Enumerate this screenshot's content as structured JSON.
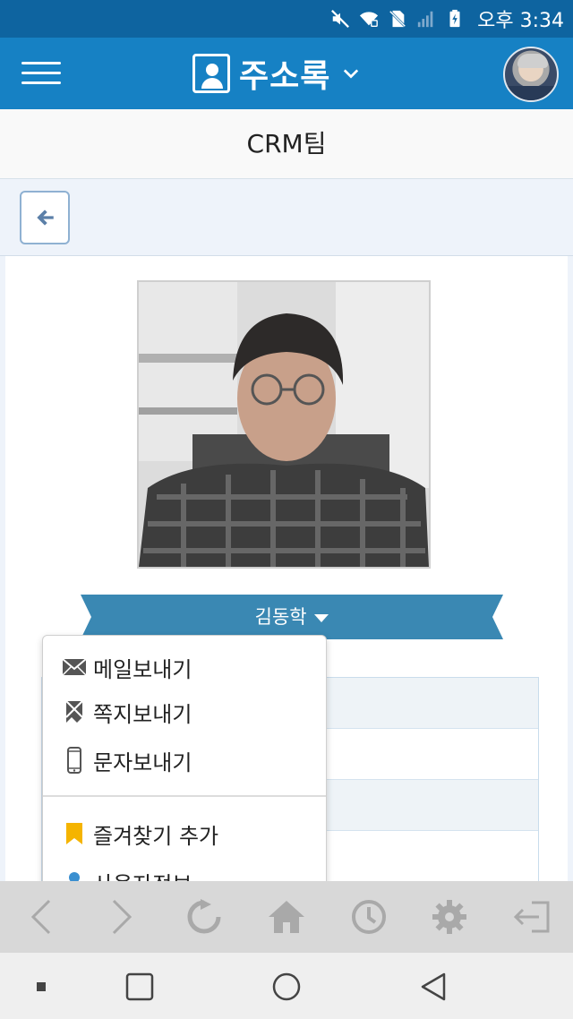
{
  "status_bar": {
    "time": "오후 3:34",
    "icons": [
      "mute-icon",
      "wifi-icon",
      "no-sim-icon",
      "signal-icon",
      "battery-charging-icon"
    ]
  },
  "header": {
    "title": "주소록",
    "menu_icon": "hamburger-icon",
    "title_icon": "address-book-icon",
    "dropdown_icon": "chevron-down-icon",
    "avatar": "user-avatar"
  },
  "team": {
    "name": "CRM팀"
  },
  "back_button": {
    "icon": "arrow-left-icon"
  },
  "profile": {
    "name": "김동학",
    "name_dropdown_icon": "caret-down-icon"
  },
  "menu": {
    "items": [
      {
        "label": "메일보내기",
        "icon": "envelope-icon"
      },
      {
        "label": "쪽지보내기",
        "icon": "note-icon"
      },
      {
        "label": "문자보내기",
        "icon": "mobile-phone-icon"
      },
      {
        "label": "즐겨찾기 추가",
        "icon": "bookmark-icon"
      },
      {
        "label": "사용자정보",
        "icon": "user-icon"
      }
    ]
  },
  "toolbar": {
    "buttons": [
      "back-icon",
      "forward-icon",
      "refresh-icon",
      "home-icon",
      "history-icon",
      "settings-icon",
      "logout-icon"
    ]
  },
  "navbar": {
    "buttons": [
      "recent-apps-dot",
      "overview-square",
      "home-circle",
      "back-triangle"
    ]
  },
  "colors": {
    "status_bar": "#0e64a0",
    "app_bar": "#1681c4",
    "ribbon": "#3a88b3",
    "bookmark": "#f5b400",
    "user_icon": "#3a8fd0"
  }
}
